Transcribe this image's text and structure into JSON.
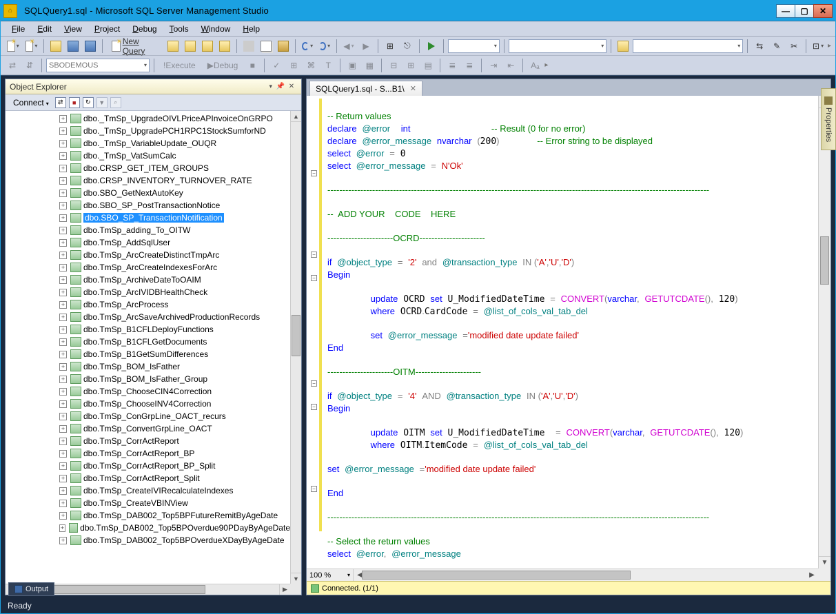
{
  "titlebar": {
    "title": "SQLQuery1.sql  -  Microsoft SQL Server Management Studio"
  },
  "menu": {
    "items": [
      "File",
      "Edit",
      "View",
      "Project",
      "Debug",
      "Tools",
      "Window",
      "Help"
    ]
  },
  "toolbar": {
    "new_query": "New Query",
    "execute": "Execute",
    "debug": "Debug",
    "db_combo": "SBODEMOUS"
  },
  "object_explorer": {
    "title": "Object Explorer",
    "connect": "Connect",
    "selected_index": 8,
    "items": [
      "dbo._TmSp_UpgradeOIVLPriceAPInvoiceOnGRPO",
      "dbo._TmSp_UpgradePCH1RPC1StockSumforND",
      "dbo._TmSp_VariableUpdate_OUQR",
      "dbo._TmSp_VatSumCalc",
      "dbo.CRSP_GET_ITEM_GROUPS",
      "dbo.CRSP_INVENTORY_TURNOVER_RATE",
      "dbo.SBO_GetNextAutoKey",
      "dbo.SBO_SP_PostTransactionNotice",
      "dbo.SBO_SP_TransactionNotification",
      "dbo.TmSp_adding_To_OITW",
      "dbo.TmSp_AddSqlUser",
      "dbo.TmSp_ArcCreateDistinctTmpArc",
      "dbo.TmSp_ArcCreateIndexesForArc",
      "dbo.TmSp_ArchiveDateToOAIM",
      "dbo.TmSp_ArcIVIDBHealthCheck",
      "dbo.TmSp_ArcProcess",
      "dbo.TmSp_ArcSaveArchivedProductionRecords",
      "dbo.TmSp_B1CFLDeployFunctions",
      "dbo.TmSp_B1CFLGetDocuments",
      "dbo.TmSp_B1GetSumDifferences",
      "dbo.TmSp_BOM_IsFather",
      "dbo.TmSp_BOM_IsFather_Group",
      "dbo.TmSp_ChooseCIN4Correction",
      "dbo.TmSp_ChooseINV4Correction",
      "dbo.TmSp_ConGrpLine_OACT_recurs",
      "dbo.TmSp_ConvertGrpLine_OACT",
      "dbo.TmSp_CorrActReport",
      "dbo.TmSp_CorrActReport_BP",
      "dbo.TmSp_CorrActReport_BP_Split",
      "dbo.TmSp_CorrActReport_Split",
      "dbo.TmSp_CreateIVIRecalculateIndexes",
      "dbo.TmSp_CreateVBINView",
      "dbo.TmSp_DAB002_Top5BPFutureRemitByAgeDate",
      "dbo.TmSp_DAB002_Top5BPOverdue90PDayByAgeDate",
      "dbo.TmSp_DAB002_Top5BPOverdueXDayByAgeDate"
    ]
  },
  "editor": {
    "tab_label": "SQLQuery1.sql - S...B1\\",
    "zoom": "100 %",
    "status": "Connected. (1/1)",
    "code_html": "\n<span class=\"green\">-- Return values</span>\n<span class=\"kw\">declare</span> <span class=\"teal\">@error</span>  <span class=\"kw\">int</span>               <span class=\"green\">-- Result (0 for no error)</span>\n<span class=\"kw\">declare</span> <span class=\"teal\">@error_message</span> <span class=\"kw\">nvarchar</span> <span class=\"gray\">(</span>200<span class=\"gray\">)</span>       <span class=\"green\">-- Error string to be displayed</span>\n<span class=\"kw\">select</span> <span class=\"teal\">@error</span> <span class=\"gray\">=</span> 0\n<span class=\"kw\">select</span> <span class=\"teal\">@error_message</span> <span class=\"gray\">=</span> <span class=\"red\">N'Ok'</span>\n\n<span class=\"green\">--------------------------------------------------------------------------------------------------------------------------------</span>\n\n<span class=\"green\">--  ADD YOUR    CODE    HERE</span>\n\n<span class=\"green\">----------------------OCRD----------------------</span>\n\n<span class=\"kw\">if</span> <span class=\"teal\">@object_type</span> <span class=\"gray\">=</span> <span class=\"red\">'2'</span> <span class=\"gray\">and</span> <span class=\"teal\">@transaction_type</span> <span class=\"gray\">IN (</span><span class=\"red\">'A'</span><span class=\"gray\">,</span><span class=\"red\">'U'</span><span class=\"gray\">,</span><span class=\"red\">'D'</span><span class=\"gray\">)</span>\n<span class=\"kw\">Begin</span>\n\n        <span class=\"kw\">update</span> OCRD <span class=\"kw\">set</span> U_ModifiedDateTime <span class=\"gray\">=</span> <span class=\"func\">CONVERT</span><span class=\"gray\">(</span><span class=\"kw\">varchar</span><span class=\"gray\">,</span> <span class=\"func\">GETUTCDATE</span><span class=\"gray\">(),</span> 120<span class=\"gray\">)</span>\n        <span class=\"kw\">where</span> OCRD<span class=\"gray\">.</span>CardCode <span class=\"gray\">=</span> <span class=\"teal\">@list_of_cols_val_tab_del</span>\n\n        <span class=\"kw\">set</span> <span class=\"teal\">@error_message</span> <span class=\"gray\">=</span><span class=\"red\">'modified date update failed'</span>\n<span class=\"kw\">End</span>\n\n<span class=\"green\">----------------------OITM----------------------</span>\n\n<span class=\"kw\">if</span> <span class=\"teal\">@object_type</span> <span class=\"gray\">=</span> <span class=\"red\">'4'</span> <span class=\"gray\">AND</span> <span class=\"teal\">@transaction_type</span> <span class=\"gray\">IN (</span><span class=\"red\">'A'</span><span class=\"gray\">,</span><span class=\"red\">'U'</span><span class=\"gray\">,</span><span class=\"red\">'D'</span><span class=\"gray\">)</span>\n<span class=\"kw\">Begin</span>\n\n        <span class=\"kw\">update</span> OITM <span class=\"kw\">set</span> U_ModifiedDateTime  <span class=\"gray\">=</span> <span class=\"func\">CONVERT</span><span class=\"gray\">(</span><span class=\"kw\">varchar</span><span class=\"gray\">,</span> <span class=\"func\">GETUTCDATE</span><span class=\"gray\">(),</span> 120<span class=\"gray\">)</span>\n        <span class=\"kw\">where</span> OITM<span class=\"gray\">.</span>ItemCode <span class=\"gray\">=</span> <span class=\"teal\">@list_of_cols_val_tab_del</span>\n\n<span class=\"kw\">set</span> <span class=\"teal\">@error_message</span> <span class=\"gray\">=</span><span class=\"red\">'modified date update failed'</span>\n\n<span class=\"kw\">End</span>\n\n<span class=\"green\">--------------------------------------------------------------------------------------------------------------------------------</span>\n\n<span class=\"green\">-- Select the return values</span>\n<span class=\"kw\">select</span> <span class=\"teal\">@error</span><span class=\"gray\">,</span> <span class=\"teal\">@error_message</span>"
  },
  "side_panel": {
    "label": "Properties"
  },
  "output_button": "Output",
  "statusbar": {
    "text": "Ready"
  }
}
